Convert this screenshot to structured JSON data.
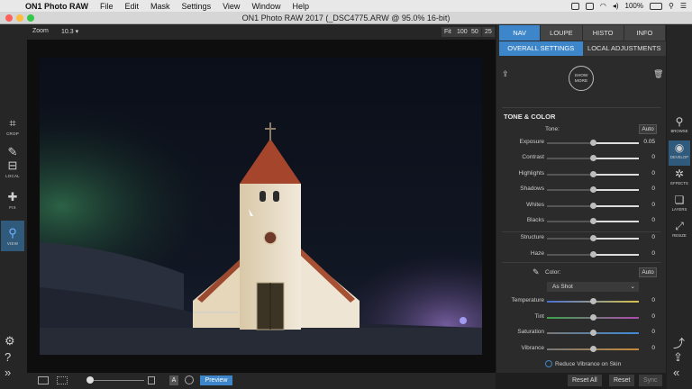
{
  "menubar": {
    "apple": "",
    "items": [
      "ON1 Photo RAW",
      "File",
      "Edit",
      "Mask",
      "Settings",
      "View",
      "Window",
      "Help"
    ],
    "battery": "100%",
    "icons": [
      "dropbox-icon",
      "battery-status-icon",
      "wifi-icon",
      "volume-icon",
      "search-icon",
      "list-icon"
    ]
  },
  "window": {
    "title": "ON1 Photo RAW 2017 (_DSC4775.ARW @ 95.0% 16-bit)"
  },
  "lefttools": [
    {
      "name": "crop",
      "label": "CROP",
      "glyph": "⌗"
    },
    {
      "name": "retouch",
      "label": "",
      "glyph": "✎"
    },
    {
      "name": "local",
      "label": "LOCAL",
      "glyph": "⊟"
    },
    {
      "name": "fix",
      "label": "FIX",
      "glyph": "✚"
    },
    {
      "name": "view",
      "label": "VIEW",
      "glyph": "⚲"
    }
  ],
  "canvas": {
    "zoom_label": "Zoom",
    "zoom_value": "10.3",
    "zoom_buttons": [
      "Fit",
      "100",
      "50",
      "25"
    ]
  },
  "bottombar": {
    "preview": "Preview",
    "mode_letter": "A"
  },
  "panel": {
    "tabs": [
      "NAV",
      "LOUPE",
      "HISTO",
      "INFO"
    ],
    "subtabs": [
      "OVERALL SETTINGS",
      "LOCAL ADJUSTMENTS"
    ],
    "show_more_1": "SHOW",
    "show_more_2": "MORE",
    "section_title": "TONE & COLOR",
    "tone_label": "Tone:",
    "auto": "Auto",
    "sliders": [
      {
        "label": "Exposure",
        "value": "0.05",
        "pos": 0.5
      },
      {
        "label": "Contrast",
        "value": "0",
        "pos": 0.5
      },
      {
        "label": "Highlights",
        "value": "0",
        "pos": 0.5
      },
      {
        "label": "Shadows",
        "value": "0",
        "pos": 0.5
      },
      {
        "label": "Whites",
        "value": "0",
        "pos": 0.5
      },
      {
        "label": "Blacks",
        "value": "0",
        "pos": 0.5
      },
      {
        "label": "Structure",
        "value": "0",
        "pos": 0.5
      },
      {
        "label": "Haze",
        "value": "0",
        "pos": 0.5
      }
    ],
    "color_label": "Color:",
    "white_balance": "As Shot",
    "color_sliders": [
      {
        "label": "Temperature",
        "value": "0",
        "pos": 0.5
      },
      {
        "label": "Tint",
        "value": "0",
        "pos": 0.5
      },
      {
        "label": "Saturation",
        "value": "0",
        "pos": 0.5
      },
      {
        "label": "Vibrance",
        "value": "0",
        "pos": 0.5
      }
    ],
    "reduce_vibrance": "Reduce Vibrance on Skin",
    "reset_all": "Reset All",
    "reset": "Reset",
    "sync": "Sync"
  },
  "modules": [
    {
      "label": "BROWSE",
      "glyph": "⚲"
    },
    {
      "label": "DEVELOP",
      "glyph": "◉"
    },
    {
      "label": "EFFECTS",
      "glyph": "✲"
    },
    {
      "label": "LAYERS",
      "glyph": "❏"
    },
    {
      "label": "RESIZE",
      "glyph": "⤢"
    }
  ],
  "colors": {
    "accent": "#3d86c9",
    "panel_bg": "#2b2b2b"
  }
}
